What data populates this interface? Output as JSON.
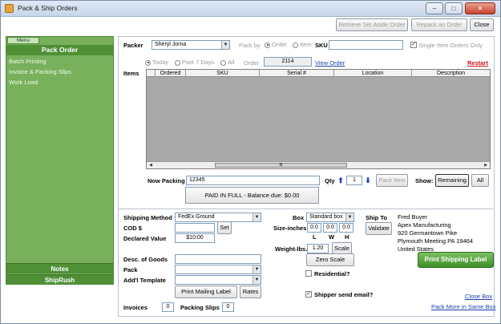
{
  "window": {
    "title": "Pack & Ship Orders",
    "minimize": "–",
    "maximize": "□",
    "close": "×"
  },
  "toolbar": {
    "retrieve_label": "Retrieve Set Aside Order",
    "repack_label": "Repack an Order",
    "close_label": "Close"
  },
  "sidebar": {
    "menu_tab": "Menu",
    "header": "Pack Order",
    "items": [
      {
        "label": "Batch Printing"
      },
      {
        "label": "Invoice & Packing Slips"
      },
      {
        "label": "Work Load"
      }
    ],
    "notes_label": "Notes",
    "shiprush_label": "ShipRush"
  },
  "packer": {
    "label": "Packer",
    "value": "Sheryl Jorna",
    "pack_by_label": "Pack by",
    "option_order": "Order",
    "option_item": "Item",
    "sku_label": "SKU",
    "sku_value": "",
    "single_item_label": "Single Item Orders Only"
  },
  "filter": {
    "today": "Today",
    "past7": "Past 7 Days",
    "all": "All",
    "order_label": "Order",
    "order_value": "2114",
    "view_order": "View Order",
    "restart": "Restart"
  },
  "items_grid": {
    "label": "Items",
    "columns": [
      "Ordered",
      "SKU",
      "Serial #",
      "Location",
      "Description"
    ],
    "scroll_thumb": "III"
  },
  "packing": {
    "now_packing_label": "Now Packing",
    "now_packing_value": "12345",
    "qty_label": "Qty",
    "qty_value": "1",
    "up_arrow": "⬆",
    "down_arrow": "⬇",
    "pack_item_label": "Pack Item",
    "show_label": "Show:",
    "remaining_label": "Remaining",
    "all_label": "All",
    "paid_status": "PAID IN FULL - Balance due: $0.00"
  },
  "shipping": {
    "method_label": "Shipping Method",
    "method_value": "FedEx Ground",
    "cod_label": "COD $",
    "cod_value": "",
    "set_label": "Set",
    "declared_label": "Declared Value",
    "declared_value": "$10:00",
    "desc_label": "Desc. of Goods",
    "desc_value": "",
    "pack_label": "Pack",
    "pack_value": "",
    "template_label": "Add'l Template",
    "template_value": "",
    "print_mailing_label": "Print Mailing Label",
    "rates_label": "Rates",
    "invoices_label": "Invoices",
    "invoices_value": "0",
    "packing_slips_label": "Packing Slips",
    "packing_slips_value": "0"
  },
  "box": {
    "box_label": "Box",
    "box_value": "Standard box",
    "size_label": "Size-inches",
    "size_l": "0.0",
    "size_w": "0.0",
    "size_h": "0.0",
    "l": "L",
    "w": "W",
    "h": "H",
    "weight_label": "Weight-lbs.",
    "weight_value": "1.20",
    "scale_label": "Scale",
    "zero_scale_label": "Zero Scale",
    "residential_label": "Residential?",
    "shipper_email_label": "Shipper send email?"
  },
  "shipto": {
    "label": "Ship To",
    "validate_label": "Validate",
    "lines": [
      "Fred Buyer",
      "Apex Manufacturing",
      "920 Germantown Pike",
      "Plymouth Meeting PA 19464",
      "United States"
    ],
    "print_shipping_label": "Print Shipping Label",
    "close_box": "Close Box",
    "pack_more": "Pack More in Same Box"
  }
}
